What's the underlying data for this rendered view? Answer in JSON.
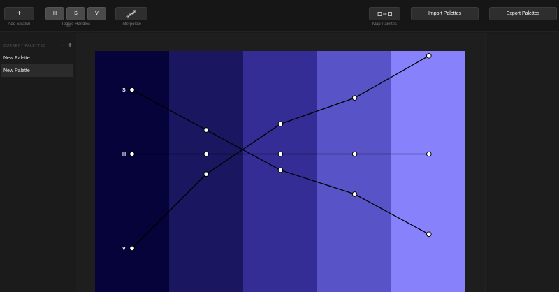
{
  "toolbar": {
    "add_swatch": {
      "button": "+",
      "label": "Add Swatch"
    },
    "toggle_handles": {
      "buttons": [
        "H",
        "S",
        "V"
      ],
      "label": "Toggle Handles"
    },
    "interpolate": {
      "label": "Interpolate"
    },
    "map_palettes": {
      "label": "Map Palettes"
    },
    "import_palettes": "Import Palettes",
    "export_palettes": "Export Palettes"
  },
  "sidebar": {
    "title": "CURRENT PALETTES",
    "remove": "−",
    "add": "+",
    "items": [
      {
        "label": "New Palette",
        "active": false
      },
      {
        "label": "New Palette",
        "active": true
      }
    ]
  },
  "palette": {
    "swatches": [
      "#05033a",
      "#1a1660",
      "#342d95",
      "#5953c8",
      "#8782fb"
    ],
    "curves": {
      "S": {
        "label": "S",
        "levels": [
          0.82,
          0.62,
          0.42,
          0.3,
          0.1
        ]
      },
      "H": {
        "label": "H",
        "levels": [
          0.5,
          0.5,
          0.5,
          0.5,
          0.5
        ]
      },
      "V": {
        "label": "V",
        "levels": [
          0.03,
          0.4,
          0.65,
          0.78,
          0.99
        ]
      }
    }
  }
}
